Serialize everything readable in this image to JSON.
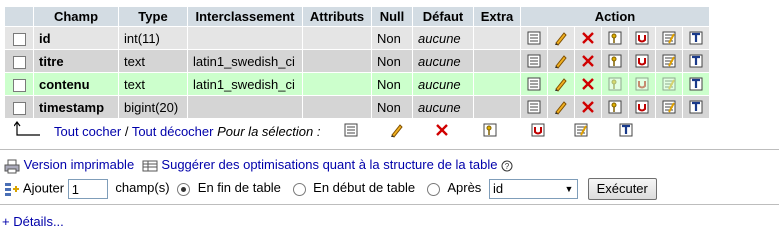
{
  "table": {
    "headers": [
      "Champ",
      "Type",
      "Interclassement",
      "Attributs",
      "Null",
      "Défaut",
      "Extra",
      "Action"
    ],
    "rows": [
      {
        "name": "id",
        "type": "int(11)",
        "collation": "",
        "attributes": "",
        "null": "Non",
        "default": "aucune",
        "extra": ""
      },
      {
        "name": "titre",
        "type": "text",
        "collation": "latin1_swedish_ci",
        "attributes": "",
        "null": "Non",
        "default": "aucune",
        "extra": ""
      },
      {
        "name": "contenu",
        "type": "text",
        "collation": "latin1_swedish_ci",
        "attributes": "",
        "null": "Non",
        "default": "aucune",
        "extra": ""
      },
      {
        "name": "timestamp",
        "type": "bigint(20)",
        "collation": "",
        "attributes": "",
        "null": "Non",
        "default": "aucune",
        "extra": ""
      }
    ],
    "highlighted_row": 2,
    "action_icons": [
      "browse-distinct-icon",
      "edit-icon",
      "drop-icon",
      "primary-key-icon",
      "unique-icon",
      "index-icon",
      "fulltext-icon"
    ]
  },
  "selection": {
    "check_all": "Tout cocher",
    "separator": " / ",
    "uncheck_all": "Tout décocher",
    "for_selection": "Pour la sélection :"
  },
  "links": {
    "print_view": "Version imprimable",
    "propose_structure": "Suggérer des optimisations quant à la structure de la table"
  },
  "add_fields": {
    "label": "Ajouter",
    "count": "1",
    "unit": "champ(s)",
    "at_end": "En fin de table",
    "at_beginning": "En début de table",
    "after": "Après",
    "after_field": "id",
    "selected_option": "at_end",
    "submit": "Exécuter"
  },
  "details": "+ Détails..."
}
